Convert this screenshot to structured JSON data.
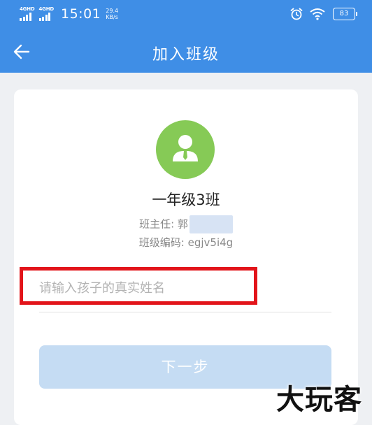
{
  "status_bar": {
    "signal_1": "4GHD",
    "signal_2": "4GHD",
    "time": "15:01",
    "net_speed_value": "29.4",
    "net_speed_unit": "KB/s",
    "battery": "83",
    "icons": [
      "signal-icon",
      "alarm-icon",
      "wifi-icon",
      "battery-icon"
    ]
  },
  "nav": {
    "title": "加入班级",
    "back_icon": "arrow-left-icon"
  },
  "class_info": {
    "avatar_icon": "teacher-avatar-icon",
    "avatar_color": "#86ca56",
    "name": "一年级3班",
    "teacher_label": "班主任: 郭",
    "code_label": "班级编码: egjv5i4g"
  },
  "form": {
    "name_input_placeholder": "请输入孩子的真实姓名",
    "name_input_value": "",
    "next_button": "下一步"
  },
  "watermark": "大玩客",
  "colors": {
    "header": "#3f8ee6",
    "button_disabled": "#c5dcf3",
    "highlight": "#e2141a"
  }
}
